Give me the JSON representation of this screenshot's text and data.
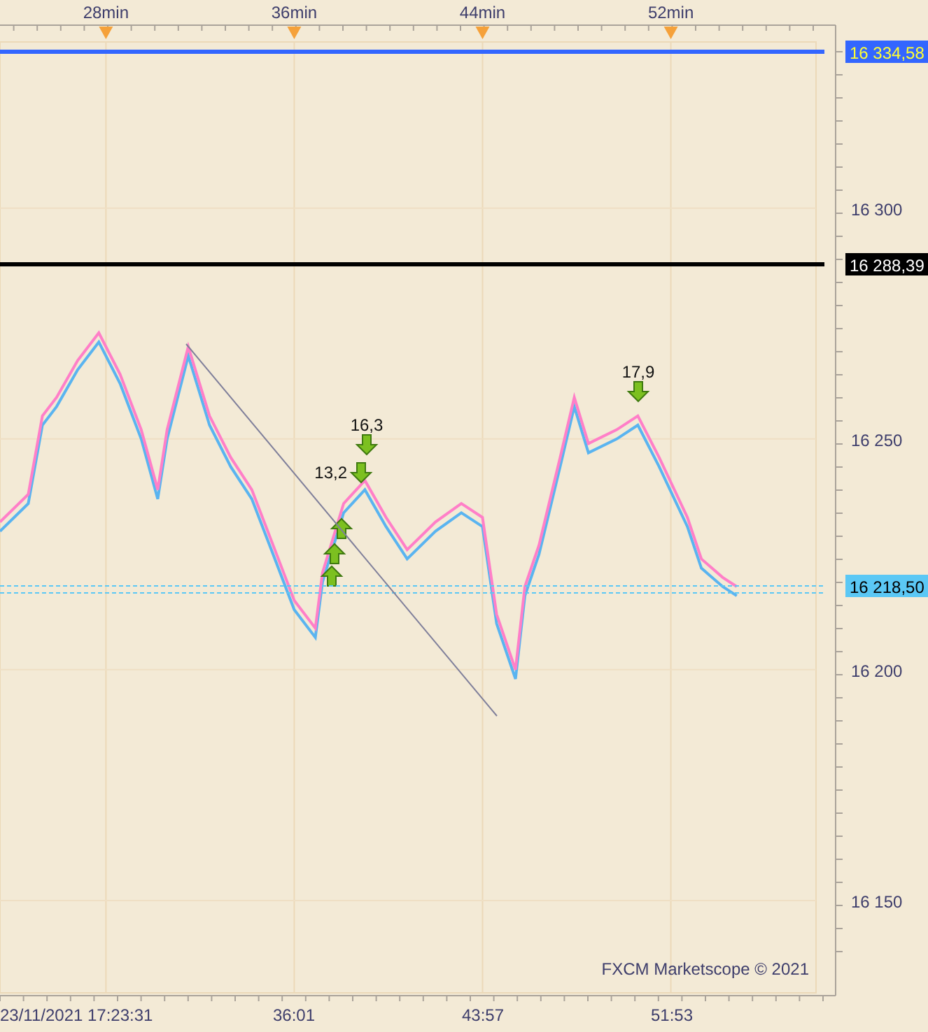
{
  "chart": {
    "chart_data": {
      "type": "line",
      "grid": true,
      "xlim": [
        23.5,
        59.0
      ],
      "ylim": [
        16130,
        16336
      ],
      "xticks": [
        {
          "value": 28,
          "label": "28min"
        },
        {
          "value": 36,
          "label": "36min"
        },
        {
          "value": 44,
          "label": "44min"
        },
        {
          "value": 52,
          "label": "52min"
        }
      ],
      "yticks": [
        {
          "value": 16150,
          "label": "16 150"
        },
        {
          "value": 16200,
          "label": "16 200"
        },
        {
          "value": 16250,
          "label": "16 250"
        },
        {
          "value": 16300,
          "label": "16 300"
        }
      ],
      "x": [
        23.5,
        24.7,
        25.3,
        25.9,
        26.8,
        27.7,
        28.6,
        29.5,
        30.2,
        30.6,
        31.5,
        32.4,
        33.3,
        34.2,
        35.1,
        36.0,
        36.9,
        37.2,
        38.1,
        39.0,
        39.9,
        40.8,
        42.0,
        43.1,
        44.0,
        44.6,
        45.4,
        45.8,
        46.4,
        47.3,
        47.9,
        48.5,
        49.7,
        50.6,
        51.5,
        52.7,
        53.3,
        54.2,
        54.8
      ],
      "series": [
        {
          "color": "#ff7fc8",
          "values": [
            16232,
            16238,
            16255,
            16259,
            16267,
            16273,
            16264,
            16252,
            16239,
            16252,
            16270,
            16255,
            16246,
            16239,
            16227,
            16215,
            16209,
            16221,
            16236,
            16241,
            16233,
            16226,
            16232,
            16236,
            16233,
            16212,
            16200,
            16218,
            16227,
            16246,
            16259,
            16249,
            16252,
            16255,
            16246,
            16233,
            16224,
            16220,
            16218
          ]
        },
        {
          "color": "#5ab4f0",
          "values": [
            16230,
            16236,
            16253,
            16257,
            16265,
            16271,
            16262,
            16250,
            16237,
            16250,
            16268,
            16253,
            16244,
            16237,
            16225,
            16213,
            16207,
            16219,
            16234,
            16239,
            16231,
            16224,
            16230,
            16234,
            16231,
            16210,
            16198,
            16216,
            16225,
            16244,
            16257,
            16247,
            16250,
            16253,
            16244,
            16231,
            16222,
            16218,
            16216
          ]
        }
      ]
    },
    "price_lines": [
      {
        "label": "16 334,58",
        "color": "#3366ff"
      },
      {
        "label": "16 288,39",
        "color": "#000000"
      },
      {
        "label": "16 218,50",
        "color": "#5bc8f5"
      }
    ],
    "trade_markers": [
      {
        "kind": "buy"
      },
      {
        "kind": "buy"
      },
      {
        "kind": "buy"
      },
      {
        "kind": "sell",
        "label": "13,2"
      },
      {
        "kind": "sell",
        "label": "16,3"
      },
      {
        "kind": "sell",
        "label": "17,9"
      }
    ],
    "bottom_axis": [
      "23/11/2021 17:23:31",
      "36:01",
      "43:57",
      "51:53"
    ],
    "footer": "FXCM Marketscope © 2021"
  }
}
